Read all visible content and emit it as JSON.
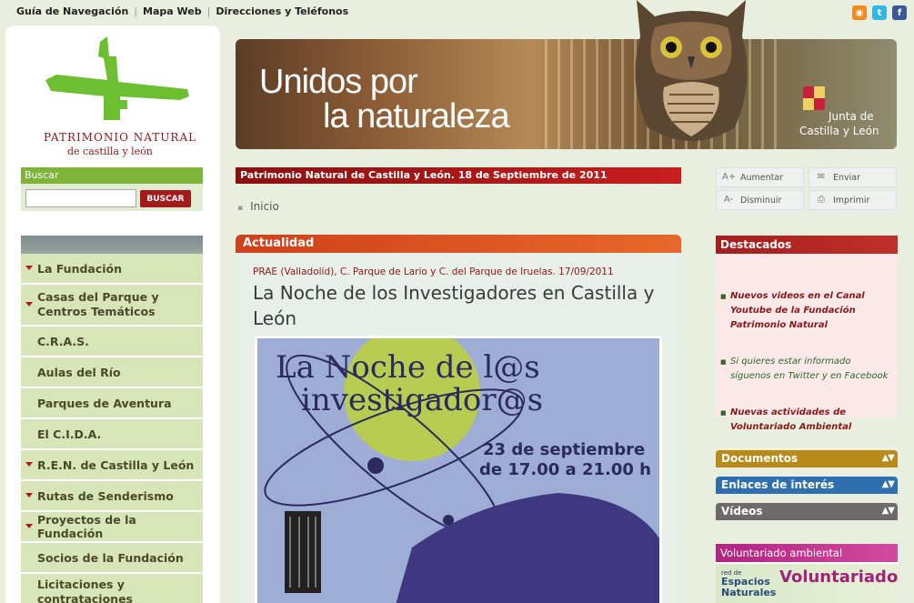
{
  "top_nav": {
    "items": [
      "Guía de Navegación",
      "Mapa Web",
      "Direcciones y Teléfonos"
    ],
    "separator": "|"
  },
  "social": [
    {
      "icon": "rss-icon",
      "color": "#f08a24",
      "glyph": "◉"
    },
    {
      "icon": "twitter-icon",
      "color": "#33b5e5",
      "glyph": "t"
    },
    {
      "icon": "facebook-icon",
      "color": "#3b5998",
      "glyph": "f"
    }
  ],
  "logo": {
    "line1": "PATRIMONIO NATURAL",
    "line2": "de castilla y león"
  },
  "search": {
    "label": "Buscar",
    "placeholder": "",
    "button": "BUSCAR"
  },
  "menu": [
    {
      "label": "La Fundación",
      "arrow": true
    },
    {
      "label": "Casas del Parque y Centros Temáticos",
      "arrow": true
    },
    {
      "label": "C.R.A.S.",
      "arrow": false
    },
    {
      "label": "Aulas del Río",
      "arrow": false
    },
    {
      "label": "Parques de Aventura",
      "arrow": false
    },
    {
      "label": "El C.I.D.A.",
      "arrow": false
    },
    {
      "label": "R.E.N. de Castilla y León",
      "arrow": true
    },
    {
      "label": "Rutas de Senderismo",
      "arrow": true
    },
    {
      "label": "Proyectos de la Fundación",
      "arrow": true
    },
    {
      "label": "Socios de la Fundación",
      "arrow": false
    },
    {
      "label": "Licitaciones y contrataciones",
      "arrow": false
    }
  ],
  "banner": {
    "headline_1": "Unidos por",
    "headline_2": "la naturaleza",
    "brand_1": "Junta de",
    "brand_2": "Castilla y León"
  },
  "date_bar": "Patrimonio Natural de Castilla y León. 18 de Septiembre de 2011",
  "breadcrumb": "Inicio",
  "actualidad": {
    "header": "Actualidad",
    "place": "PRAE (Valladolid), C. Parque de Lario y C. del Parque de Iruelas. 17/09/2011",
    "title": "La Noche de los Investigadores en Castilla y León",
    "poster": {
      "line1": "La Noche de l@s",
      "line2": "investigador@s",
      "line3": "23 de septiembre",
      "line4": "de 17.00 a 21.00 h"
    }
  },
  "tools": [
    {
      "label": "Aumentar",
      "icon": "zoom-in-icon"
    },
    {
      "label": "Enviar",
      "icon": "envelope-icon"
    },
    {
      "label": "Disminuir",
      "icon": "zoom-out-icon"
    },
    {
      "label": "Imprimir",
      "icon": "printer-icon"
    }
  ],
  "destacados": {
    "header": "Destacados",
    "items": [
      {
        "text": "Nuevos videos en el Canal Youtube de la Fundación Patrimonio Natural",
        "color": "#8a1a1a",
        "bold": true
      },
      {
        "text": "Si quieres estar informado síguenos en Twitter y en Facebook",
        "color": "#2a6a2a",
        "bold": false
      },
      {
        "text": "Nuevas actividades de Voluntariado Ambiental",
        "color": "#8a1a1a",
        "bold": true
      }
    ]
  },
  "sections": [
    {
      "label": "Documentos",
      "color": "#b88a1a"
    },
    {
      "label": "Enlaces de interés",
      "color": "#2f6fb0"
    },
    {
      "label": "Vídeos",
      "color": "#6f6a6a"
    }
  ],
  "voluntariado": {
    "header": "Voluntariado ambiental",
    "small": "red de",
    "net": "Espacios Naturales",
    "big": "Voluntariado"
  }
}
